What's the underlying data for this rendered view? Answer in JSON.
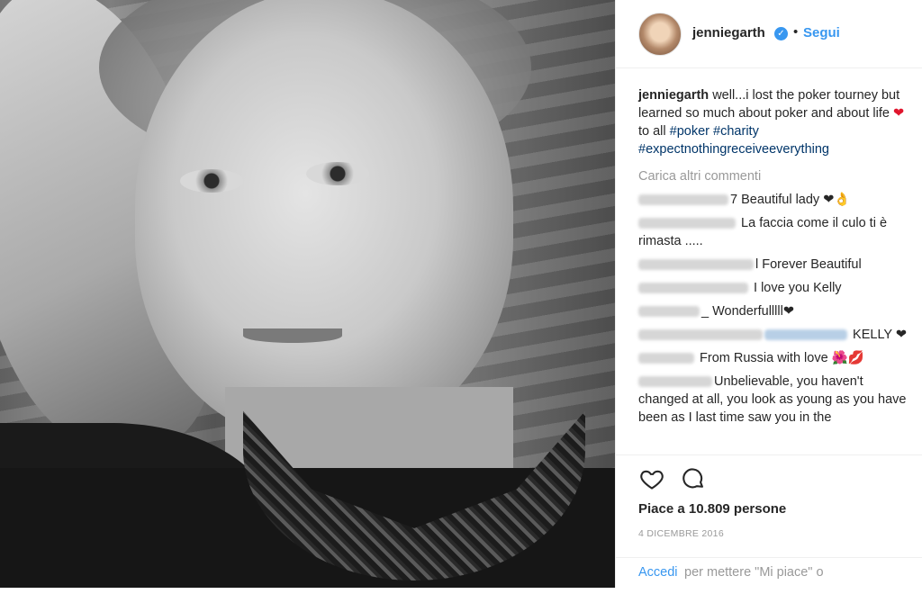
{
  "header": {
    "username": "jenniegarth",
    "verified_glyph": "✓",
    "separator": "•",
    "follow_label": "Segui"
  },
  "caption": {
    "username": "jenniegarth",
    "text_1": "well...i lost the poker tourney but learned so much about poker and about life ",
    "heart": "❤",
    "text_2": "to all ",
    "tags": [
      "#poker",
      "#charity",
      "#expectnothingreceiveeverything"
    ]
  },
  "load_more": "Carica altri commenti",
  "comments": [
    {
      "user_visible": "7",
      "text": " Beautiful lady ❤👌"
    },
    {
      "user_visible": "",
      "text": "La faccia come il culo ti è rimasta ....."
    },
    {
      "user_visible": "l",
      "text": " Forever Beautiful"
    },
    {
      "user_visible": "",
      "text": "I love you Kelly"
    },
    {
      "user_visible": "_",
      "text": " Wonderfulllll❤"
    },
    {
      "user_visible": "",
      "text": "KELLY ❤"
    },
    {
      "user_visible": "",
      "text": "From Russia with love 🌺💋"
    },
    {
      "user_visible": "",
      "text": "Unbelievable, you haven't changed at all, you look as young as you have been as I last time saw you in the"
    }
  ],
  "likes_text": "Piace a 10.809 persone",
  "date": "4 DICEMBRE 2016",
  "login": {
    "link": "Accedi",
    "text": "per mettere \"Mi piace\" o"
  },
  "icons": [
    "heart-icon",
    "comment-icon",
    "verified-icon"
  ],
  "colors": {
    "link": "#3897f0",
    "hashtag": "#003569",
    "muted": "#999999",
    "heart": "#e0152d"
  }
}
